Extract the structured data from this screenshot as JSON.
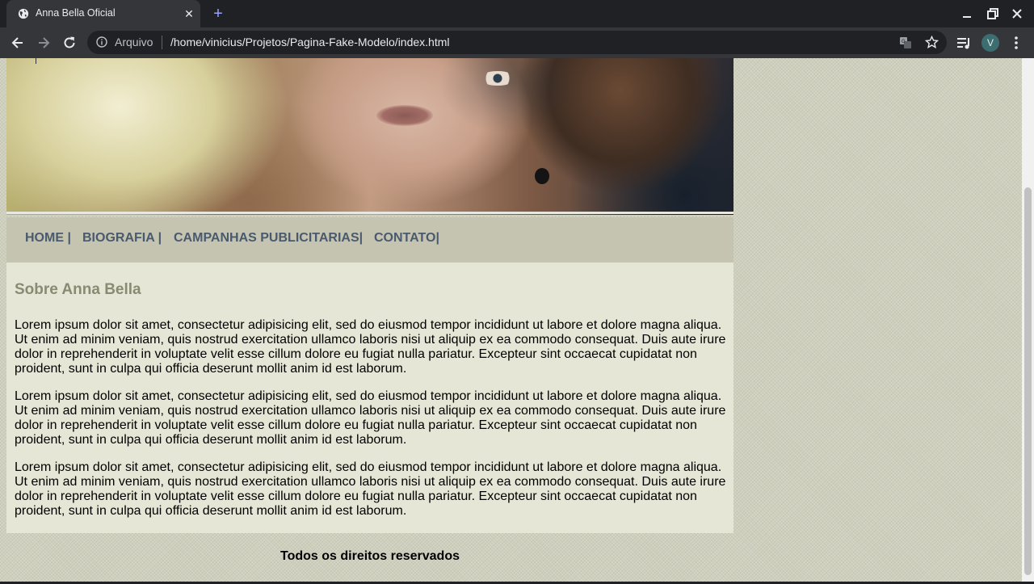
{
  "browser": {
    "tab_title": "Anna Bella Oficial",
    "address": {
      "scheme_label": "Arquivo",
      "url": "/home/vinicius/Projetos/Pagina-Fake-Modelo/index.html"
    },
    "profile_initial": "V",
    "accent_color": "#9aa0ff"
  },
  "page": {
    "nav": {
      "items": [
        "HOME |",
        "BIOGRAFIA |",
        "CAMPANHAS PUBLICITARIAS|",
        "CONTATO|"
      ]
    },
    "content": {
      "heading": "Sobre Anna Bella",
      "paragraphs": [
        "Lorem ipsum dolor sit amet, consectetur adipisicing elit, sed do eiusmod tempor incididunt ut labore et dolore magna aliqua. Ut enim ad minim veniam, quis nostrud exercitation ullamco laboris nisi ut aliquip ex ea commodo consequat. Duis aute irure dolor in reprehenderit in voluptate velit esse cillum dolore eu fugiat nulla pariatur. Excepteur sint occaecat cupidatat non proident, sunt in culpa qui officia deserunt mollit anim id est laborum.",
        "Lorem ipsum dolor sit amet, consectetur adipisicing elit, sed do eiusmod tempor incididunt ut labore et dolore magna aliqua. Ut enim ad minim veniam, quis nostrud exercitation ullamco laboris nisi ut aliquip ex ea commodo consequat. Duis aute irure dolor in reprehenderit in voluptate velit esse cillum dolore eu fugiat nulla pariatur. Excepteur sint occaecat cupidatat non proident, sunt in culpa qui officia deserunt mollit anim id est laborum.",
        "Lorem ipsum dolor sit amet, consectetur adipisicing elit, sed do eiusmod tempor incididunt ut labore et dolore magna aliqua. Ut enim ad minim veniam, quis nostrud exercitation ullamco laboris nisi ut aliquip ex ea commodo consequat. Duis aute irure dolor in reprehenderit in voluptate velit esse cillum dolore eu fugiat nulla pariatur. Excepteur sint occaecat cupidatat non proident, sunt in culpa qui officia deserunt mollit anim id est laborum."
      ]
    },
    "footer": "Todos os direitos reservados",
    "colors": {
      "nav_text": "#4a5a6e",
      "heading": "#8a8a74",
      "content_bg": "#e6e6d6",
      "nav_bg": "#c4c4b0"
    }
  }
}
